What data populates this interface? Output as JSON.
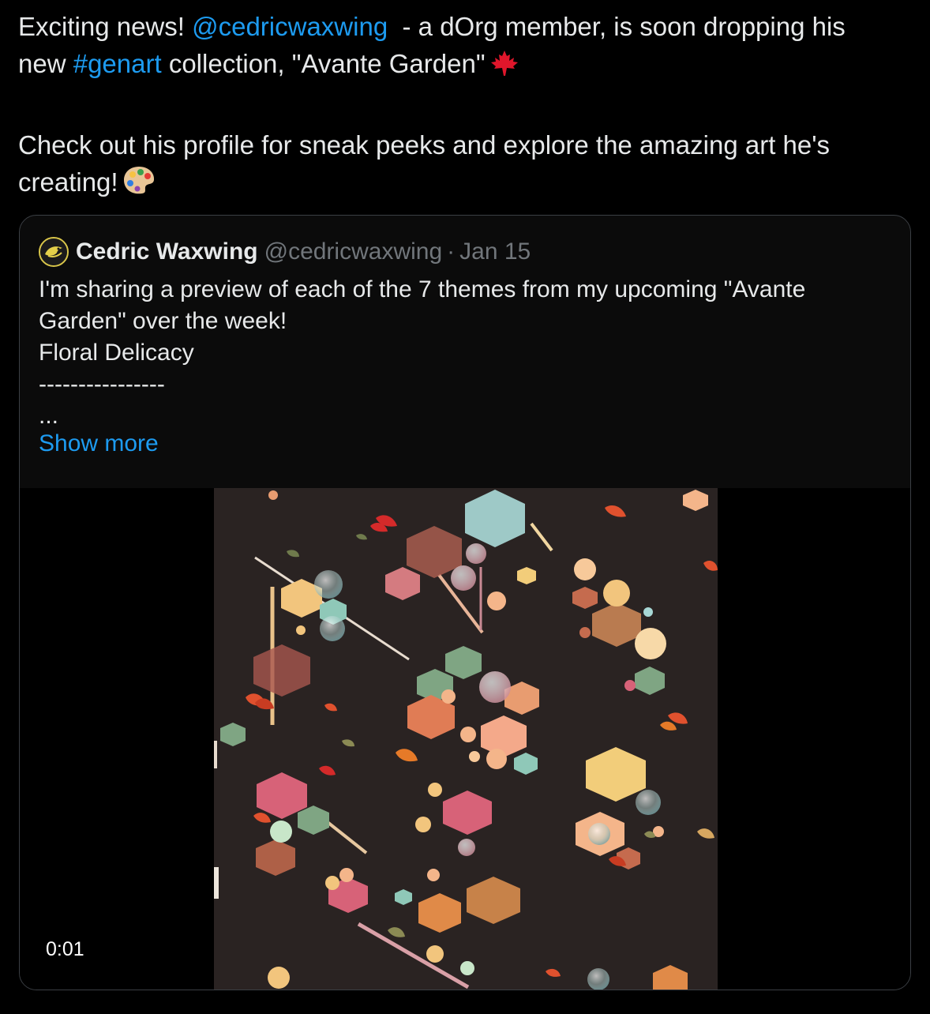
{
  "tweet": {
    "line1_text": "Exciting news! ",
    "mention": "@cedricwaxwing",
    "line1_rest": "  - a dOrg member, is soon dropping his",
    "line2_prefix": "new ",
    "hashtag": "#genart",
    "line2_rest": " collection, \"Avante Garden\"",
    "line2_emoji": "maple-leaf",
    "para2_text": "Check out his profile for sneak peeks and explore the amazing art he's creating!",
    "para2_emoji": "artist-palette"
  },
  "quote": {
    "author_name": "Cedric Waxwing",
    "author_handle": "@cedricwaxwing",
    "separator": "·",
    "date": "Jan 15",
    "body_lines": [
      "I'm sharing a preview of each of the 7 themes from my upcoming \"Avante",
      "Garden\" over the week!",
      "Floral Delicacy",
      "----------------",
      "..."
    ],
    "show_more_label": "Show more",
    "video": {
      "timestamp": "0:01",
      "background_color": "#2a2322"
    }
  },
  "colors": {
    "link": "#1d9bf0",
    "text": "#e7e9ea",
    "muted": "#71767b",
    "background": "#000000",
    "card_border": "#3b3f44"
  }
}
